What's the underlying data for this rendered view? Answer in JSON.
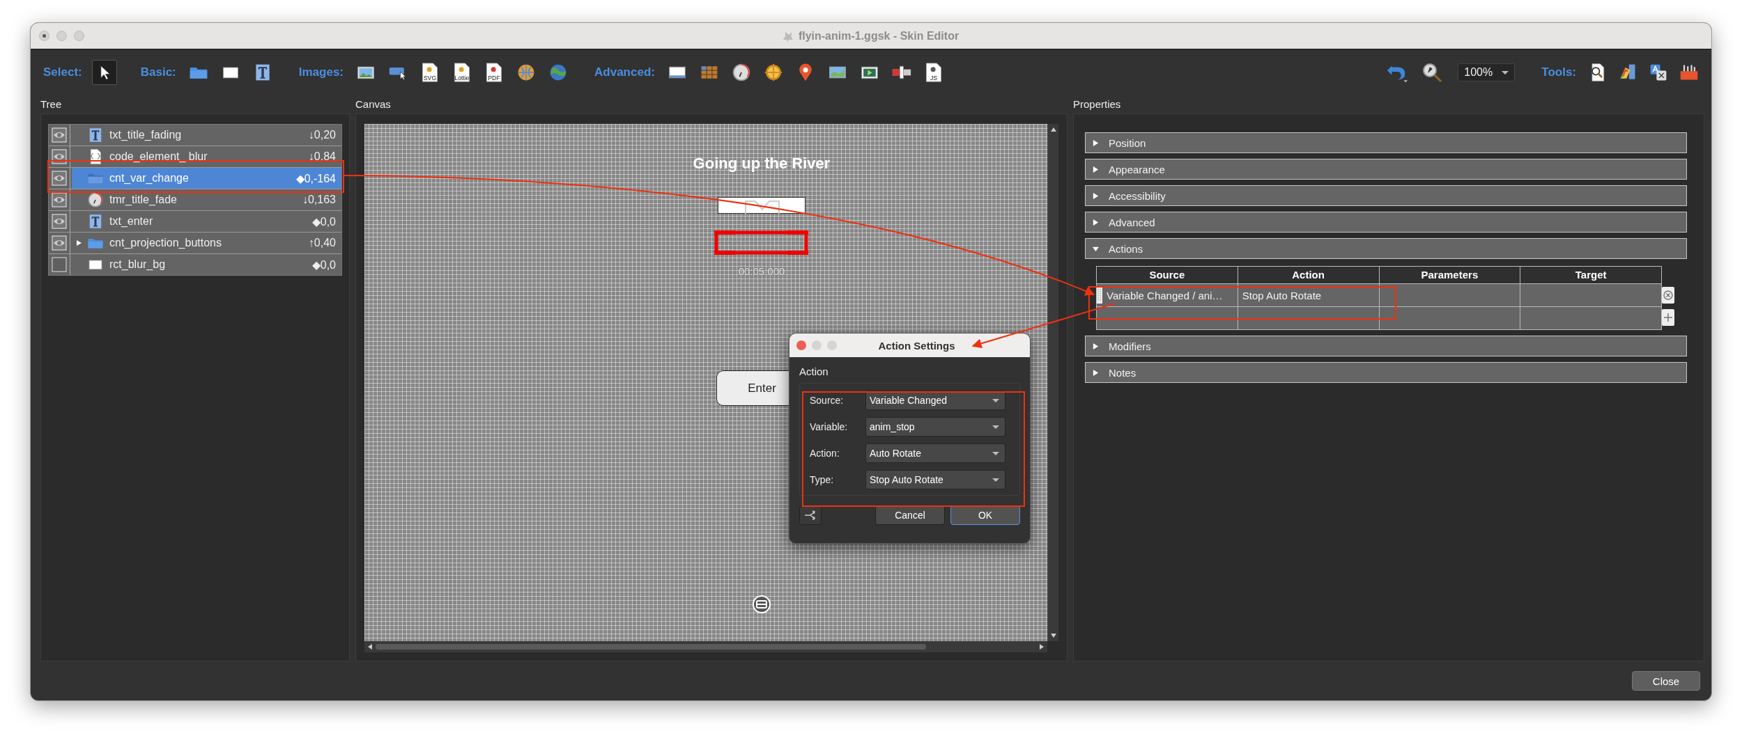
{
  "window": {
    "title": "flyin-anim-1.ggsk - Skin Editor"
  },
  "toolbar": {
    "groups": [
      {
        "label": "Select:",
        "tools": [
          {
            "kind": "pointer",
            "selected": true
          }
        ]
      },
      {
        "label": "Basic:",
        "tools": [
          {
            "kind": "folder",
            "selected": false
          },
          {
            "kind": "rectangle",
            "selected": false
          },
          {
            "kind": "text",
            "selected": false
          }
        ]
      },
      {
        "label": "Images:",
        "tools": [
          {
            "kind": "image",
            "selected": false
          },
          {
            "kind": "image-cursor",
            "selected": false
          },
          {
            "kind": "file",
            "badge": "SVG",
            "selected": false
          },
          {
            "kind": "file",
            "badge": "Lottie",
            "selected": false
          },
          {
            "kind": "file",
            "badge": "PDF",
            "selected": false
          },
          {
            "kind": "globe",
            "selected": false
          },
          {
            "kind": "earth",
            "selected": false
          }
        ]
      },
      {
        "label": "Advanced:",
        "tools": [
          {
            "kind": "screen",
            "selected": false
          },
          {
            "kind": "tiles",
            "selected": false
          },
          {
            "kind": "dial",
            "selected": false
          },
          {
            "kind": "crosshair",
            "selected": false
          },
          {
            "kind": "pin",
            "selected": false
          },
          {
            "kind": "map",
            "selected": false
          },
          {
            "kind": "video",
            "selected": false
          },
          {
            "kind": "slider",
            "selected": false
          },
          {
            "kind": "file",
            "badge": "JS",
            "selected": false
          }
        ]
      }
    ],
    "zoom": "100%",
    "tools_group": {
      "label": "Tools:",
      "tools": [
        {
          "kind": "file-search"
        },
        {
          "kind": "palette"
        },
        {
          "kind": "translate"
        },
        {
          "kind": "toolbox"
        }
      ]
    }
  },
  "tree": {
    "title": "Tree",
    "items": [
      {
        "kind": "text",
        "name": "txt_title_fading",
        "value": "↓0,20",
        "visible": true,
        "expander": false,
        "selected": false
      },
      {
        "kind": "code",
        "name": "code_element_ blur",
        "value": "↓0,84",
        "visible": true,
        "expander": false,
        "selected": false
      },
      {
        "kind": "folder",
        "name": "cnt_var_change",
        "value": "◆0,-164",
        "visible": true,
        "expander": false,
        "selected": true
      },
      {
        "kind": "timer",
        "name": "tmr_title_fade",
        "value": "↓0,163",
        "visible": true,
        "expander": false,
        "selected": false
      },
      {
        "kind": "text",
        "name": "txt_enter",
        "value": "◆0,0",
        "visible": true,
        "expander": false,
        "selected": false
      },
      {
        "kind": "folder",
        "name": "cnt_projection_buttons",
        "value": "↑0,40",
        "visible": true,
        "expander": true,
        "selected": false
      },
      {
        "kind": "rectangle",
        "name": "rct_blur_bg",
        "value": "◆0,0",
        "visible": false,
        "expander": false,
        "selected": false
      }
    ]
  },
  "canvas": {
    "title": "Canvas",
    "heading": "Going up the River",
    "timer": "00:05:000",
    "button": "Enter"
  },
  "dialog": {
    "title": "Action Settings",
    "group": "Action",
    "fields": [
      {
        "label": "Source:",
        "value": "Variable Changed"
      },
      {
        "label": "Variable:",
        "value": "anim_stop"
      },
      {
        "label": "Action:",
        "value": "Auto Rotate"
      },
      {
        "label": "Type:",
        "value": "Stop Auto Rotate"
      }
    ],
    "buttons": [
      {
        "label": "Cancel",
        "default": false
      },
      {
        "label": "OK",
        "default": true
      }
    ]
  },
  "properties": {
    "title": "Properties",
    "sections": [
      {
        "title": "Position",
        "expanded": false
      },
      {
        "title": "Appearance",
        "expanded": false
      },
      {
        "title": "Accessibility",
        "expanded": false
      },
      {
        "title": "Advanced",
        "expanded": false
      },
      {
        "title": "Actions",
        "expanded": true,
        "table": {
          "columns": [
            "Source",
            "Action",
            "Parameters",
            "Target"
          ],
          "rows": [
            {
              "source": "Variable Changed / ani…",
              "action": "Stop Auto Rotate"
            }
          ]
        }
      },
      {
        "title": "Modifiers",
        "expanded": false
      },
      {
        "title": "Notes",
        "expanded": false
      }
    ]
  },
  "footer": {
    "button": "Close"
  }
}
